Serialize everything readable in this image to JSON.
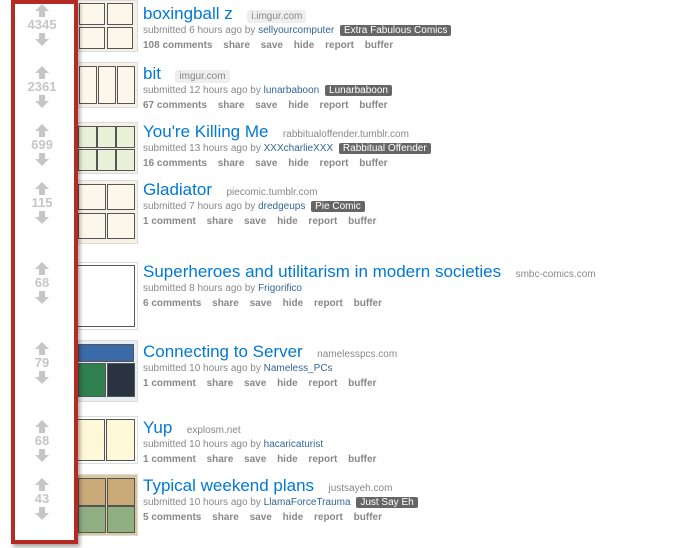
{
  "posts": [
    {
      "score": "4345",
      "title": "boxingball z",
      "domain": "i.imgur.com",
      "meta": "submitted 6 hours ago by",
      "author": "sellyourcomputer",
      "flair": "Extra Fabulous Comics",
      "comments": "108 comments"
    },
    {
      "score": "2361",
      "title": "bit",
      "domain": "imgur.com",
      "meta": "submitted 12 hours ago by",
      "author": "lunarbaboon",
      "flair": "Lunarbaboon",
      "comments": "67 comments"
    },
    {
      "score": "699",
      "title": "You're Killing Me",
      "domain": "rabbitualoffender.tumblr.com",
      "meta": "submitted 13 hours ago by",
      "author": "XXXcharlieXXX",
      "flair": "Rabbitual Offender",
      "comments": "16 comments"
    },
    {
      "score": "115",
      "title": "Gladiator",
      "domain": "piecomic.tumblr.com",
      "meta": "submitted 7 hours ago by",
      "author": "dredgeups",
      "flair": "Pie Comic",
      "comments": "1 comment"
    },
    {
      "score": "68",
      "title": "Superheroes and utilitarism in modern societies",
      "domain": "smbc-comics.com",
      "meta": "submitted 8 hours ago by",
      "author": "Frigorifico",
      "flair": "",
      "comments": "6 comments"
    },
    {
      "score": "79",
      "title": "Connecting to Server",
      "domain": "namelesspcs.com",
      "meta": "submitted 10 hours ago by",
      "author": "Nameless_PCs",
      "flair": "",
      "comments": "1 comment"
    },
    {
      "score": "68",
      "title": "Yup",
      "domain": "explosm.net",
      "meta": "submitted 10 hours ago by",
      "author": "hacaricaturist",
      "flair": "",
      "comments": "1 comment"
    },
    {
      "score": "43",
      "title": "Typical weekend plans",
      "domain": "justsayeh.com",
      "meta": "submitted 10 hours ago by",
      "author": "LlamaForceTrauma",
      "flair": "Just Say Eh",
      "comments": "5 comments"
    }
  ],
  "actions": {
    "share": "share",
    "save": "save",
    "hide": "hide",
    "report": "report",
    "buffer": "buffer"
  },
  "icons": {
    "up": "upvote-arrow-icon",
    "down": "downvote-arrow-icon"
  },
  "colors": {
    "title_link": "#0079d3",
    "score": "#c6c6c6",
    "highlight": "#b52a23",
    "flair_bg": "#666666"
  }
}
